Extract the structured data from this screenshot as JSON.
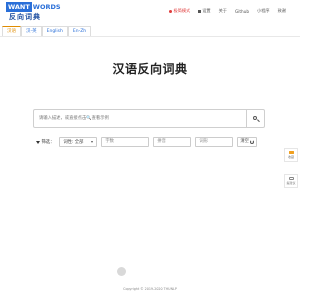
{
  "logo": {
    "want": "WANT",
    "words": "WORDS",
    "subtitle": "反向词典"
  },
  "topnav": {
    "items": [
      {
        "label": "极简模式",
        "icon": "record-dot-icon"
      },
      {
        "label": "设置",
        "icon": "settings-icon"
      },
      {
        "label": "关于"
      },
      {
        "label": "Github"
      },
      {
        "label": "小程序"
      },
      {
        "label": "致谢"
      }
    ]
  },
  "tabs": [
    {
      "label": "汉语",
      "active": true
    },
    {
      "label": "汉-英",
      "active": false
    },
    {
      "label": "English",
      "active": false
    },
    {
      "label": "En-Zh",
      "active": false
    }
  ],
  "title": "汉语反向词典",
  "search": {
    "placeholder": "请输入描述，或直接点击🔍查看示例",
    "button_icon": "search-icon"
  },
  "filters": {
    "label": "筛选：",
    "pos_select": "词性: 全部",
    "length_placeholder": "字数",
    "pinyin_placeholder": "拼音",
    "char_placeholder": "词形",
    "clear_label": "清空"
  },
  "side": [
    {
      "label": "收藏",
      "icon": "folder-icon"
    },
    {
      "label": "提建议",
      "icon": "chat-icon"
    }
  ],
  "footer": "Copyright © 2019-2020 THUNLP",
  "colors": {
    "accent": "#2a6fd8",
    "active_tab": "#e08c00",
    "highlight": "#e03b3b"
  }
}
